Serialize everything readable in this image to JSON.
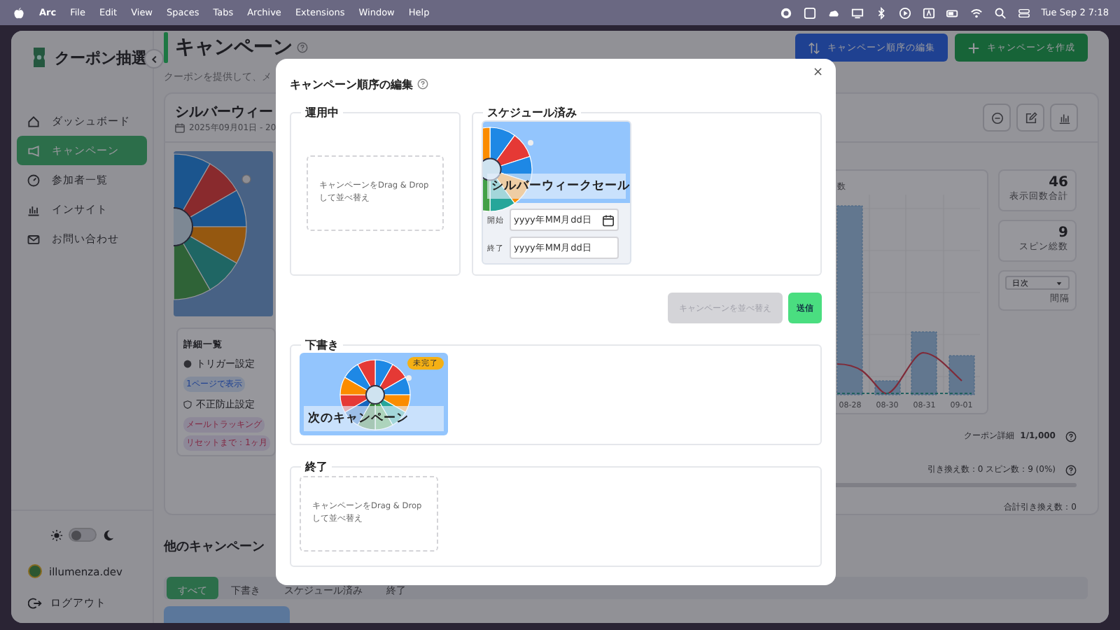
{
  "menubar": {
    "app": "Arc",
    "menus": [
      "File",
      "Edit",
      "View",
      "Spaces",
      "Tabs",
      "Archive",
      "Extensions",
      "Window",
      "Help"
    ],
    "clock": "Tue Sep 2  7:18"
  },
  "sidebar": {
    "brand": "クーポン抽選",
    "nav": [
      {
        "label": "ダッシュボード",
        "selected": false
      },
      {
        "label": "キャンペーン",
        "selected": true
      },
      {
        "label": "参加者一覧",
        "selected": false
      },
      {
        "label": "インサイト",
        "selected": false
      },
      {
        "label": "お問い合わせ",
        "selected": false
      }
    ],
    "dark_mode": false,
    "user": "illumenza.dev",
    "logout": "ログアウト"
  },
  "header": {
    "title": "キャンペーン",
    "subtitle": "クーポンを提供して、メ",
    "actions": [
      {
        "label": "キャンペーン順序の編集",
        "kind": "reorder"
      },
      {
        "label": "キャンペーンを作成",
        "kind": "create"
      }
    ]
  },
  "campaign": {
    "title": "シルバーウィー",
    "period": "2025年09月01日 - 20",
    "details": {
      "title": "詳細一覧",
      "groups": [
        {
          "kind": "trigger",
          "label": "トリガー設定",
          "tags": [
            "1ページで表示"
          ]
        },
        {
          "kind": "security",
          "label": "不正防止設定",
          "tags": [
            "メールトラッキング",
            "リセットまで：1ヶ月"
          ]
        }
      ]
    },
    "chart": {
      "axis_title": "数",
      "x_labels": [
        "08-28",
        "08-30",
        "08-31",
        "09-01"
      ]
    },
    "stats": [
      {
        "value": "46",
        "label": "表示回数合計"
      },
      {
        "value": "9",
        "label": "スピン総数"
      }
    ],
    "interval": {
      "value": "日次",
      "label": "間隔"
    },
    "coupon": {
      "label": "クーポン詳細",
      "value": "1/1,000"
    },
    "redemption": "引き換え数：0 スピン数：9 (0%)",
    "total": "合計引き換え数：0"
  },
  "other": {
    "title": "他のキャンペーン",
    "tabs": [
      {
        "label": "すべて",
        "selected": true
      },
      {
        "label": "下書き",
        "selected": false
      },
      {
        "label": "スケジュール済み",
        "selected": false
      },
      {
        "label": "終了",
        "selected": false
      }
    ]
  },
  "modal": {
    "title": "キャンペーン順序の編集",
    "close": "×",
    "top_sections": [
      {
        "title": "運用中",
        "kind": "empty",
        "placeholder": "キャンペーンをDrag & Dropして並べ替え"
      },
      {
        "title": "スケジュール済み",
        "kind": "cards",
        "cards": [
          {
            "name": "シルバーウィークセール",
            "dates": [
              {
                "label": "開始",
                "placeholder": "yyyy年MM月dd日",
                "hovered": true
              },
              {
                "label": "終了",
                "placeholder": "yyyy年MM月dd日",
                "hovered": false
              }
            ]
          }
        ]
      }
    ],
    "actions": [
      {
        "label": "キャンペーンを並べ替え",
        "disabled": true
      },
      {
        "label": "送信",
        "disabled": false
      }
    ],
    "bottom_sections": [
      {
        "title": "下書き",
        "kind": "cards",
        "cards": [
          {
            "name": "次のキャンペーン",
            "badge": "未完了"
          }
        ]
      },
      {
        "title": "終了",
        "kind": "empty",
        "placeholder": "キャンペーンをDrag & Dropして並べ替え"
      }
    ]
  }
}
